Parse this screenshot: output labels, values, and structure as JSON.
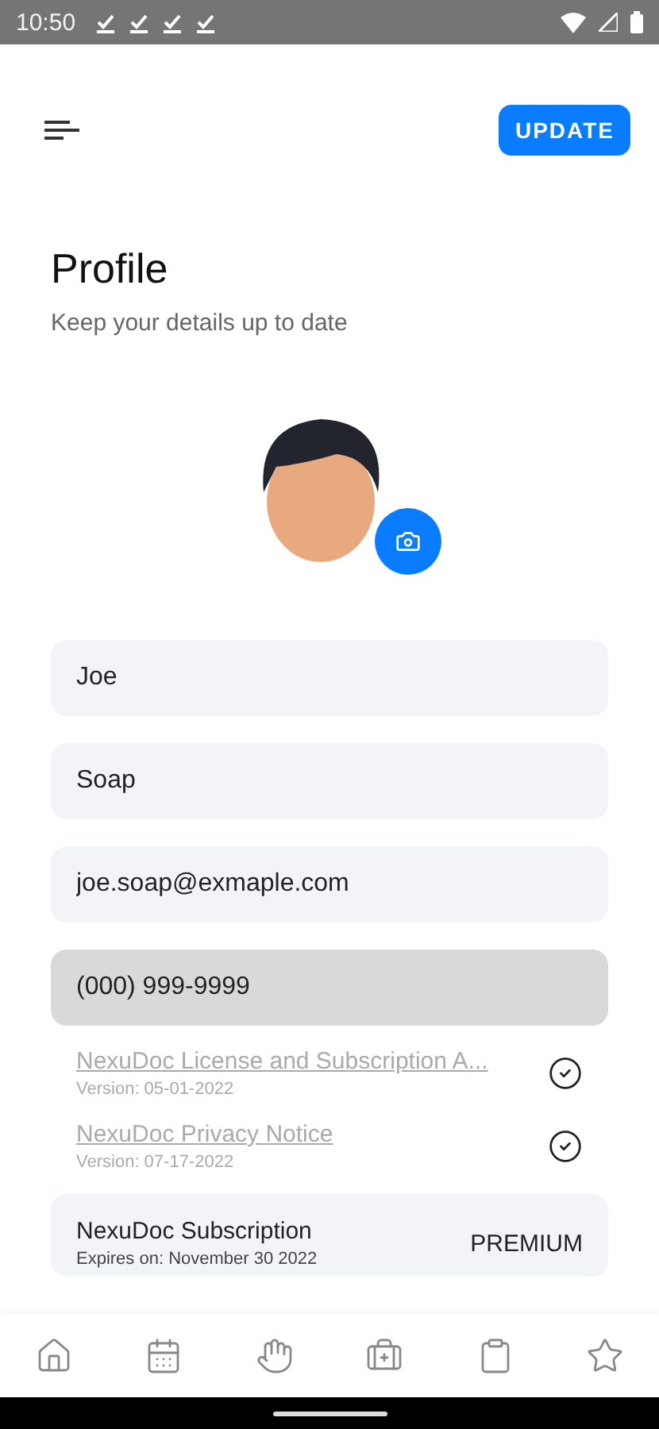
{
  "status_bar": {
    "time": "10:50",
    "notifications": [
      {
        "kind": "download"
      },
      {
        "kind": "download"
      },
      {
        "kind": "download"
      },
      {
        "kind": "download"
      }
    ]
  },
  "header": {
    "button": "UPDATE"
  },
  "title": "Profile",
  "subtitle": "Keep your details up to date",
  "fields": [
    {
      "value": "Joe",
      "disabled": false
    },
    {
      "value": "Soap",
      "disabled": false
    },
    {
      "value": "joe.soap@exmaple.com",
      "disabled": false
    },
    {
      "value": "(000) 999-9999",
      "disabled": true
    }
  ],
  "agreements": [
    {
      "title": "NexuDoc License and Subscription A...",
      "version": "Version: 05-01-2022",
      "accepted": true
    },
    {
      "title": "NexuDoc Privacy Notice",
      "version": "Version: 07-17-2022",
      "accepted": true
    }
  ],
  "subscription": {
    "title": "NexuDoc Subscription",
    "expires": "Expires on: November 30 2022",
    "plan": "PREMIUM"
  },
  "bottom_nav": [
    {
      "kind": "home"
    },
    {
      "kind": "calendar"
    },
    {
      "kind": "hand"
    },
    {
      "kind": "medkit"
    },
    {
      "kind": "clipboard"
    },
    {
      "kind": "star"
    }
  ]
}
